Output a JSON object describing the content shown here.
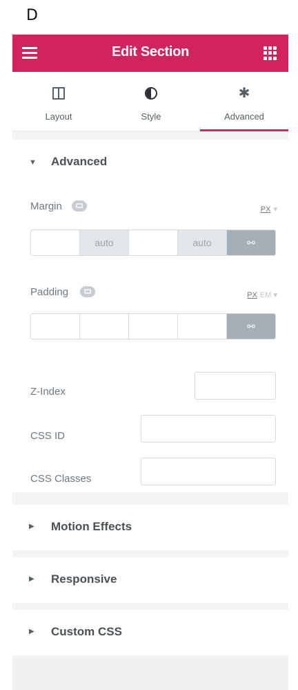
{
  "corner_letter": "D",
  "header": {
    "title": "Edit Section",
    "menu_icon": "hamburger-icon",
    "apps_icon": "grid-icon"
  },
  "tabs": [
    {
      "label": "Layout",
      "icon": "layout-columns-icon",
      "active": false
    },
    {
      "label": "Style",
      "icon": "half-circle-icon",
      "active": false
    },
    {
      "label": "Advanced",
      "icon": "gear-icon",
      "active": true
    }
  ],
  "advanced_section": {
    "title": "Advanced",
    "expanded": true,
    "margin": {
      "label": "Margin",
      "unit_active": "PX",
      "values": [
        "",
        "auto",
        "",
        "auto"
      ],
      "link_icon": "link-icon"
    },
    "padding": {
      "label": "Padding",
      "unit_active": "PX",
      "unit_other": "EM",
      "values": [
        "",
        "",
        "",
        ""
      ],
      "link_icon": "link-icon"
    },
    "z_index": {
      "label": "Z-Index",
      "value": ""
    },
    "css_id": {
      "label": "CSS ID",
      "value": ""
    },
    "css_classes": {
      "label": "CSS Classes",
      "value": ""
    }
  },
  "collapsed_sections": [
    {
      "title": "Motion Effects"
    },
    {
      "title": "Responsive"
    },
    {
      "title": "Custom CSS"
    }
  ],
  "colors": {
    "accent": "#d1245e",
    "panel_bg": "#f1f3f5",
    "text": "#6d7882"
  }
}
